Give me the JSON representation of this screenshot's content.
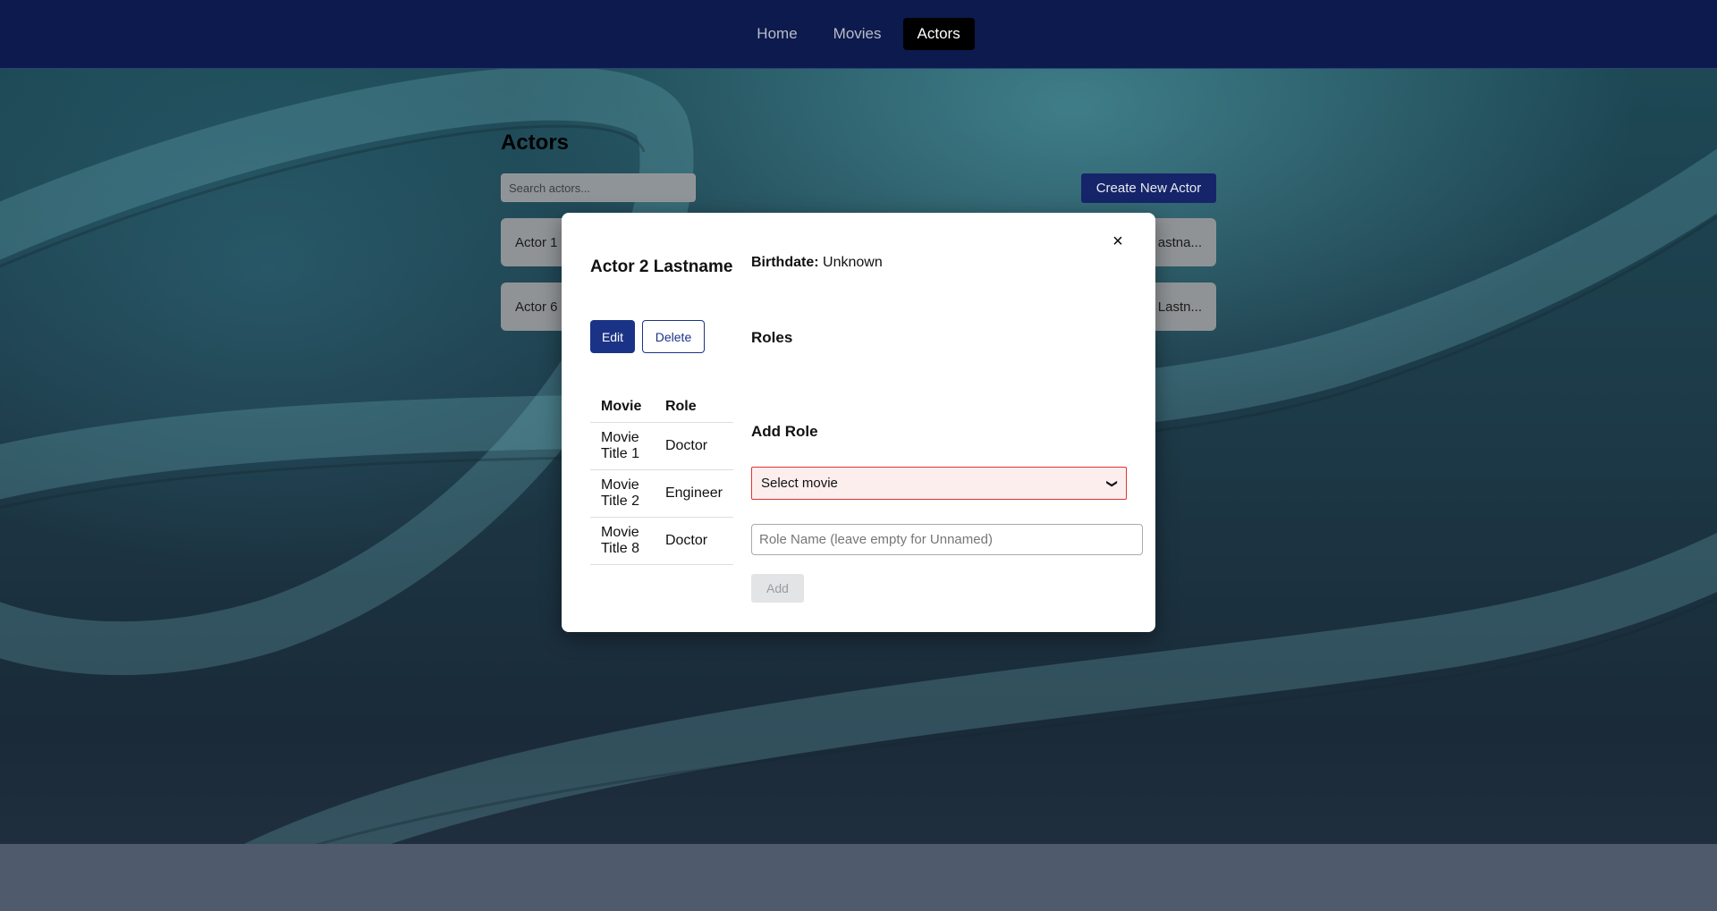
{
  "nav": {
    "items": [
      {
        "label": "Home"
      },
      {
        "label": "Movies"
      },
      {
        "label": "Actors"
      }
    ]
  },
  "page": {
    "title": "Actors",
    "search_placeholder": "Search actors...",
    "create_label": "Create New Actor",
    "cards": [
      {
        "label": "Actor 1"
      },
      {
        "label": "astna..."
      },
      {
        "label": "Actor 6"
      },
      {
        "label": "Lastn..."
      }
    ]
  },
  "modal": {
    "close_label": "×",
    "actor_name": "Actor 2 Lastname",
    "edit_label": "Edit",
    "delete_label": "Delete",
    "table": {
      "headers": [
        "Movie",
        "Role"
      ],
      "rows": [
        {
          "movie_line1": "Movie",
          "movie_line2": "Title 1",
          "role": "Doctor"
        },
        {
          "movie_line1": "Movie",
          "movie_line2": "Title 2",
          "role": "Engineer"
        },
        {
          "movie_line1": "Movie",
          "movie_line2": "Title 8",
          "role": "Doctor"
        }
      ]
    },
    "birthdate_label": "Birthdate:",
    "birthdate_value": "Unknown",
    "roles_heading": "Roles",
    "add_role_heading": "Add Role",
    "select_value": "Select movie",
    "role_placeholder": "Role Name (leave empty for Unnamed)",
    "add_label": "Add"
  }
}
